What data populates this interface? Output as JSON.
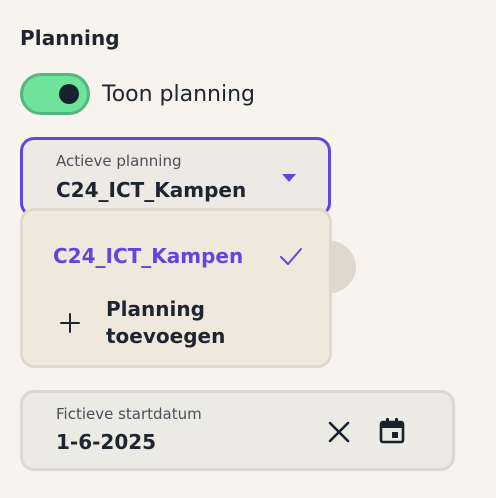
{
  "section": {
    "title": "Planning"
  },
  "toggle": {
    "label": "Toon planning",
    "on": true
  },
  "planning_select": {
    "caption": "Actieve planning",
    "value": "C24_ICT_Kampen"
  },
  "dropdown": {
    "items": [
      {
        "label": "C24_ICT_Kampen",
        "selected": true,
        "icon": "check-icon"
      },
      {
        "label_line1": "Planning",
        "label_line2": "toevoegen",
        "icon": "plus-icon"
      }
    ]
  },
  "date_field": {
    "caption": "Fictieve startdatum",
    "value": "1-6-2025",
    "clear_icon": "close-icon",
    "calendar_icon": "calendar-icon"
  },
  "colors": {
    "accent": "#6444e0",
    "toggle_on": "#6ee39c",
    "background": "#f7f4ee"
  }
}
